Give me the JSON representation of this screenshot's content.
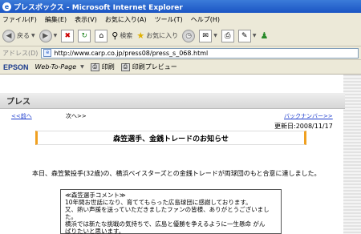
{
  "window": {
    "title": "プレスボックス - Microsoft Internet Explorer"
  },
  "menu": [
    "ファイル(F)",
    "編集(E)",
    "表示(V)",
    "お気に入り(A)",
    "ツール(T)",
    "ヘルプ(H)"
  ],
  "toolbar": {
    "back": "戻る",
    "search": "検索",
    "favorites": "お気に入り"
  },
  "address": {
    "label": "アドレス(D)",
    "url": "http://www.carp.co.jp/press08/press_s_068.html"
  },
  "epson": {
    "logo": "EPSON",
    "web_to_page": "Web-To-Page",
    "print": "印刷",
    "print_preview": "印刷プレビュー"
  },
  "page": {
    "section": "プレス",
    "prev": "<<前へ",
    "next": "次へ>>",
    "backnumber": "バックナンバー>>",
    "updated": "更新日:2008/11/17",
    "headline": "森笠選手、金銭トレードのお知らせ",
    "body": "本日、森笠繁投手(32歳)の、横浜ベイスターズとの金銭トレードが両球団のもと合意に達しました。",
    "comment": [
      "≪森笠選手コメント≫",
      "10年間お世話になり、育ててもらった広島球団に感謝しております。",
      "又、熱い声援を送っていただきましたファンの皆様、ありがとうございました。",
      "横浜では新たな挑戦の気持ちで、広島と優勝を争えるように一生懸命 がん",
      "ばりたいと思います。"
    ]
  }
}
